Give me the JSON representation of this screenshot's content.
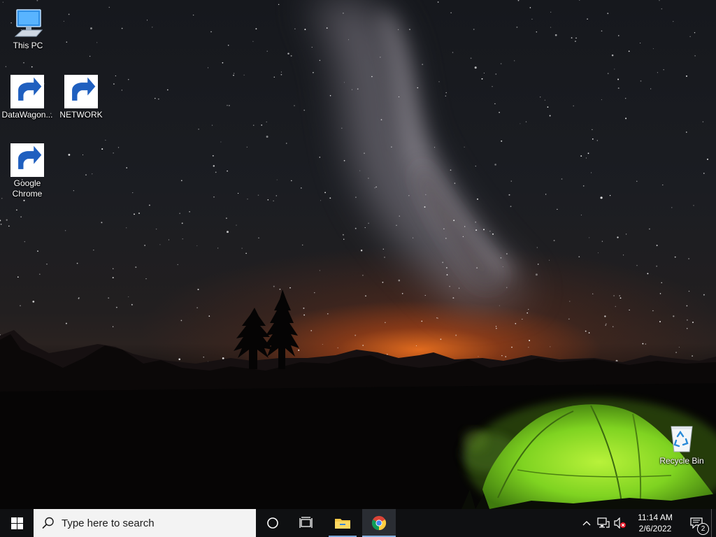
{
  "desktop": {
    "icons": [
      {
        "label": "This PC",
        "icon": "this-pc-icon"
      },
      {
        "label": "DataWagon...",
        "icon": "datawagon-icon",
        "shortcut": true
      },
      {
        "label": "NETWORK",
        "icon": "network-icon",
        "shortcut": true
      },
      {
        "label": "Google Chrome",
        "icon": "chrome-icon",
        "shortcut": true
      },
      {
        "label": "Recycle Bin",
        "icon": "recycle-bin-icon"
      }
    ]
  },
  "taskbar": {
    "search_placeholder": "Type here to search",
    "apps": [
      {
        "name": "File Explorer",
        "icon": "folder-icon"
      },
      {
        "name": "Google Chrome",
        "icon": "chrome-icon",
        "active": true
      }
    ],
    "tray": {
      "icons": [
        "chevron-up-icon",
        "network-icon",
        "volume-muted-icon"
      ]
    },
    "clock": {
      "time": "11:14 AM",
      "date": "2/6/2022"
    },
    "notifications": {
      "count": "2"
    }
  },
  "colors": {
    "taskbar": "#0f1012",
    "search_box": "#f3f3f3",
    "tent": "#7fd321",
    "horizon_glow": "#e86e1e"
  }
}
